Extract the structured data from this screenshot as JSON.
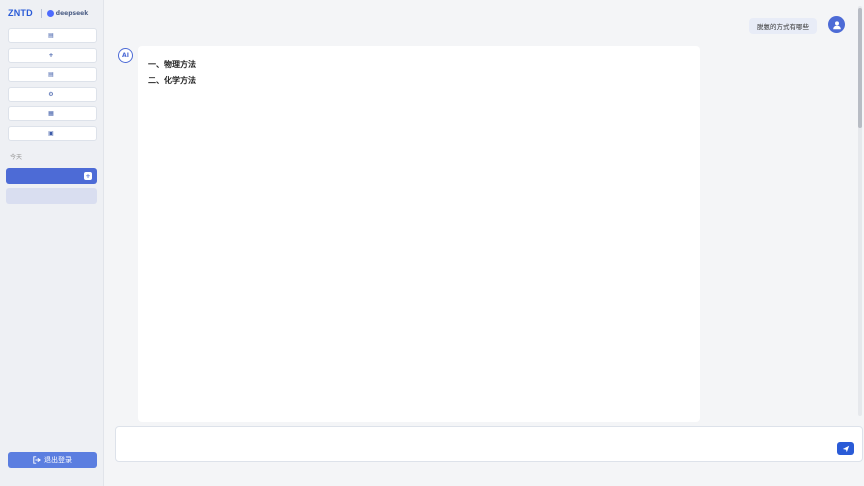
{
  "brand": {
    "logo_text": "ZNTD",
    "logo_sub": "",
    "partner": "deepseek"
  },
  "sidebar": {
    "menu": [
      {
        "icon": "document-icon",
        "glyph": "▤",
        "label": ""
      },
      {
        "icon": "plus-icon",
        "glyph": "+",
        "label": ""
      },
      {
        "icon": "list-icon",
        "glyph": "▤",
        "label": ""
      },
      {
        "icon": "gear-icon",
        "glyph": "⚙",
        "label": ""
      },
      {
        "icon": "report-icon",
        "glyph": "▦",
        "label": ""
      },
      {
        "icon": "chat-icon",
        "glyph": "▣",
        "label": ""
      }
    ],
    "history_label": "今天",
    "history_active": "",
    "history_active_more": "+",
    "history_items": [
      ""
    ],
    "logout_label": "退出登录"
  },
  "chat": {
    "user_message": "脱氨的方式有哪些",
    "ai_avatar_text": "AI",
    "think_title": "",
    "think_paragraphs": [],
    "intro": "",
    "sections": [
      {
        "heading": "一、物理方法",
        "methods": []
      },
      {
        "heading": "二、化学方法",
        "methods": []
      }
    ]
  },
  "input": {
    "placeholder": ""
  },
  "footer": "",
  "colors": {
    "accent": "#4d6bd6",
    "send": "#2a5bd7"
  }
}
